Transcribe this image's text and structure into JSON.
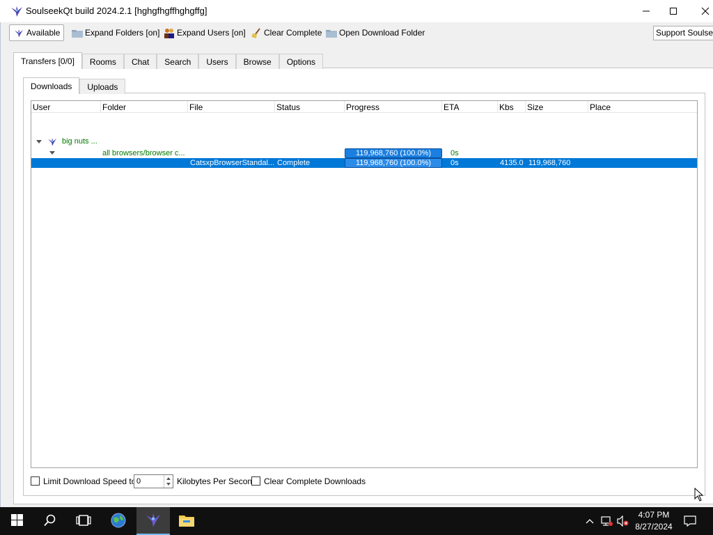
{
  "window": {
    "title": "SoulseekQt build 2024.2.1 [hghgfhgffhghgffg]"
  },
  "toolbar": {
    "status_label": "Available",
    "expand_folders_label": "Expand Folders [on]",
    "expand_users_label": "Expand Users [on]",
    "clear_complete_label": "Clear Complete",
    "open_download_folder_label": "Open Download Folder",
    "support_label": "Support Soulseek"
  },
  "main_tabs": [
    {
      "label": "Transfers [0/0]",
      "active": true
    },
    {
      "label": "Rooms"
    },
    {
      "label": "Chat"
    },
    {
      "label": "Search"
    },
    {
      "label": "Users"
    },
    {
      "label": "Browse"
    },
    {
      "label": "Options"
    }
  ],
  "sub_tabs": [
    {
      "label": "Downloads",
      "active": true
    },
    {
      "label": "Uploads"
    }
  ],
  "table": {
    "columns": [
      "User",
      "Folder",
      "File",
      "Status",
      "Progress",
      "ETA",
      "Kbs",
      "Size",
      "Place"
    ],
    "user_row": {
      "user": "big nuts ..."
    },
    "folder_row": {
      "folder": "all browsers/browser c...",
      "progress": "119,968,760 (100.0%)",
      "eta": "0s"
    },
    "file_row": {
      "file": "CatsxpBrowserStandal...",
      "status": "Complete",
      "progress": "119,968,760 (100.0%)",
      "progress_fraction": 1.0,
      "eta": "0s",
      "kbs": "4135.0",
      "size": "119,968,760",
      "place": ""
    }
  },
  "footer": {
    "limit_speed_label": "Limit Download Speed to",
    "limit_speed_value": "0",
    "unit_label": "Kilobytes Per Second",
    "clear_complete_downloads_label": "Clear Complete Downloads"
  },
  "taskbar": {
    "time": "4:07 PM",
    "date": "8/27/2024"
  },
  "colors": {
    "selection": "#0078d7",
    "progress_fill": "#1a7fe0",
    "folder_text": "#007a00",
    "taskbar": "#101010"
  }
}
